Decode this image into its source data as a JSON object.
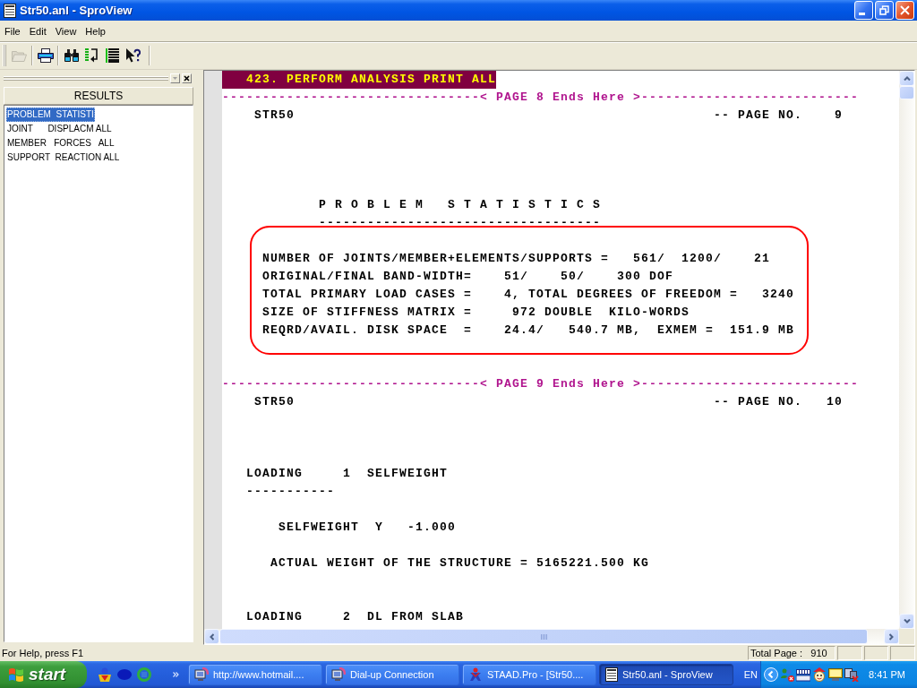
{
  "window": {
    "title": "Str50.anl - SproView"
  },
  "menu_bar": [
    {
      "label": "File"
    },
    {
      "label": "Edit"
    },
    {
      "label": "View"
    },
    {
      "label": "Help"
    }
  ],
  "toolbar": [
    {
      "disabled": true
    },
    {
      "disabled": false
    },
    {
      "disabled": false
    },
    {
      "disabled": false
    },
    {
      "disabled": false
    },
    {
      "disabled": false
    }
  ],
  "results_panel": {
    "header": "RESULTS",
    "items": [
      {
        "label": "PROBLEM  STATISTI",
        "selected": true
      },
      {
        "label": "JOINT      DISPLACM ALL",
        "selected": false
      },
      {
        "label": "MEMBER   FORCES   ALL",
        "selected": false
      },
      {
        "label": "SUPPORT  REACTION ALL",
        "selected": false
      }
    ]
  },
  "output": [
    {
      "kind": "command",
      "text": "423. PERFORM ANALYSIS PRINT ALL",
      "selected": true
    },
    {
      "kind": "page_break",
      "text": "--------------------------------< PAGE 8 Ends Here >---------------------------"
    },
    {
      "kind": "page_header",
      "title": "STR50",
      "page": "-- PAGE NO.    9"
    },
    {
      "kind": "statistics",
      "title": "P R O B L E M   S T A T I S T I C S",
      "underline": "-----------------------------------",
      "lines": [
        "NUMBER OF JOINTS/MEMBER+ELEMENTS/SUPPORTS =   561/  1200/    21",
        "ORIGINAL/FINAL BAND-WIDTH=    51/    50/    300 DOF",
        "TOTAL PRIMARY LOAD CASES =    4, TOTAL DEGREES OF FREEDOM =   3240",
        "SIZE OF STIFFNESS MATRIX =     972 DOUBLE  KILO-WORDS",
        "REQRD/AVAIL. DISK SPACE  =    24.4/   540.7 MB,  EXMEM =  151.9 MB"
      ]
    },
    {
      "kind": "page_break",
      "text": "--------------------------------< PAGE 9 Ends Here >---------------------------"
    },
    {
      "kind": "page_header",
      "title": "STR50",
      "page": "-- PAGE NO.   10"
    },
    {
      "kind": "loading",
      "title": "LOADING     1  SELFWEIGHT",
      "underline": "-----------",
      "loads": [
        "SELFWEIGHT  Y   -1.000"
      ],
      "weight": "ACTUAL WEIGHT OF THE STRUCTURE = 5165221.500 KG"
    },
    {
      "kind": "loading",
      "title": "LOADING     2  DL FROM SLAB"
    }
  ],
  "status_bar": {
    "help": "For Help, press F1",
    "total_pages": "Total Page :   910"
  },
  "taskbar": {
    "start": "start",
    "tasks": [
      {
        "label": "http://www.hotmail....",
        "selected": false
      },
      {
        "label": "Dial-up Connection",
        "selected": false
      },
      {
        "label": "STAAD.Pro - [Str50....",
        "selected": false
      },
      {
        "label": "Str50.anl - SproView",
        "selected": true
      }
    ],
    "language": "EN",
    "clock": "8:41 PM"
  }
}
